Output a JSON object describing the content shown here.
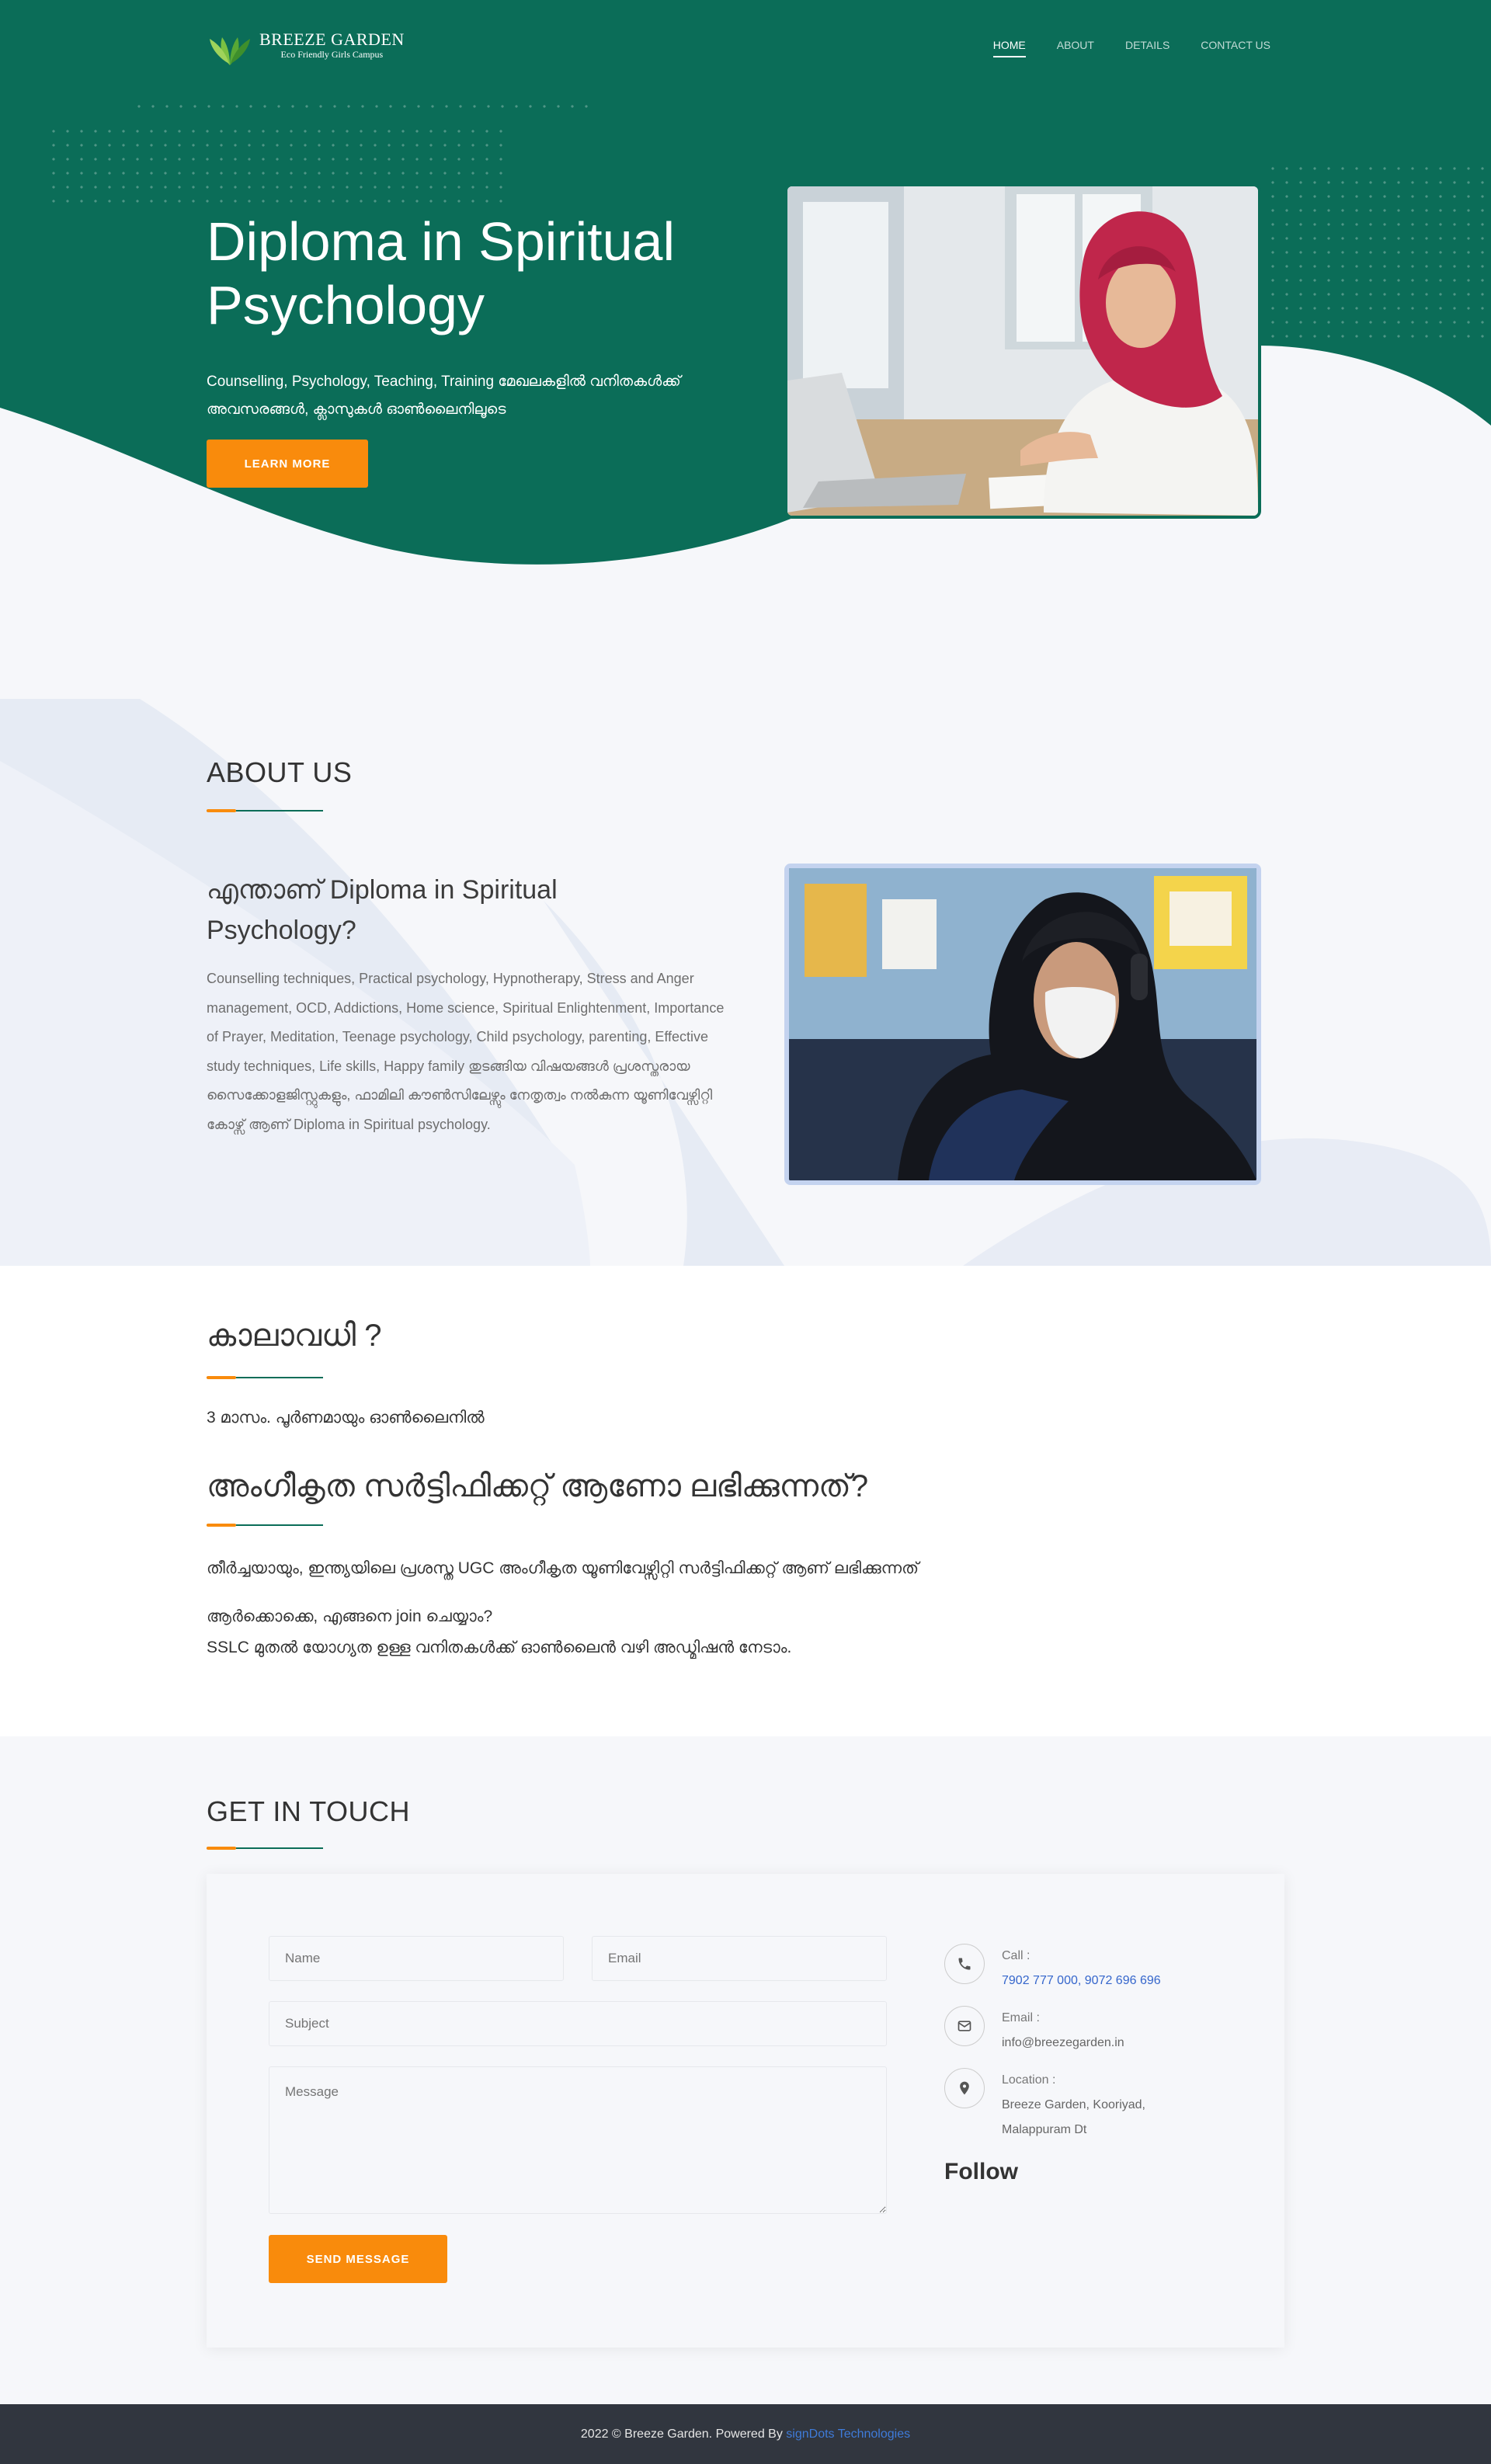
{
  "brand": {
    "name": "BREEZE GARDEN",
    "tagline": "Eco Friendly Girls Campus"
  },
  "nav": [
    {
      "label": "HOME",
      "active": true
    },
    {
      "label": "ABOUT",
      "active": false
    },
    {
      "label": "DETAILS",
      "active": false
    },
    {
      "label": "CONTACT US",
      "active": false
    }
  ],
  "hero": {
    "title": "Diploma in Spiritual Psychology",
    "description": "Counselling, Psychology, Teaching, Training മേഖലകളിൽ വനിതകൾക്ക് അവസരങ്ങൾ, ക്ലാസുകൾ ഓൺലൈനിലൂടെ",
    "button": "LEARN MORE"
  },
  "about": {
    "title": "ABOUT US",
    "heading": "എന്താണ് Diploma in Spiritual Psychology?",
    "body": "Counselling techniques, Practical psychology, Hypnotherapy, Stress and Anger management, OCD, Addictions, Home science, Spiritual Enlightenment, Importance of Prayer, Meditation, Teenage psychology, Child psychology, parenting, Effective study techniques, Life skills, Happy family തുടങ്ങിയ വിഷയങ്ങൾ പ്രശസ്തരായ സൈക്കോളജിസ്റ്റുകളും, ഫാമിലി കൗൺസിലേഴ്സും നേതൃത്വം നൽകുന്ന യൂണിവേഴ്സിറ്റി കോഴ്സ് ആണ് Diploma in Spiritual psychology."
  },
  "details": {
    "duration_title": "കാലാവധി ?",
    "duration_text": "3 മാസം. പൂർണമായും ഓൺലൈനിൽ",
    "cert_title": "അംഗീകൃത സർട്ടിഫിക്കറ്റ് ആണോ ലഭിക്കുന്നത്?",
    "cert_text": "തീർച്ചയായും, ഇന്ത്യയിലെ പ്രശസ്ത UGC അംഗീകൃത യൂണിവേഴ്സിറ്റി സർട്ടിഫിക്കറ്റ് ആണ് ലഭിക്കുന്നത്",
    "join_q": "ആർക്കൊക്കെ, എങ്ങനെ join ചെയ്യാം?",
    "join_a": "SSLC മുതൽ യോഗ്യത ഉള്ള വനിതകൾക്ക് ഓൺലൈൻ വഴി അഡ്മിഷൻ നേടാം."
  },
  "contact": {
    "title": "GET IN TOUCH",
    "form": {
      "name_placeholder": "Name",
      "email_placeholder": "Email",
      "subject_placeholder": "Subject",
      "message_placeholder": "Message",
      "send": "SEND MESSAGE"
    },
    "info": {
      "call_label": "Call :",
      "call_value": "7902 777 000, 9072 696 696",
      "email_label": "Email :",
      "email_value": "info@breezegarden.in",
      "location_label": "Location :",
      "location_line1": "Breeze Garden, Kooriyad,",
      "location_line2": "Malappuram Dt"
    },
    "follow": "Follow"
  },
  "footer": {
    "text": "2022 © Breeze Garden. Powered By",
    "link": "signDots Technologies"
  },
  "colors": {
    "brand_green": "#0b6d58",
    "accent_orange": "#f98b0c",
    "footer_bg": "#31363f",
    "link_blue": "#3566cc"
  }
}
